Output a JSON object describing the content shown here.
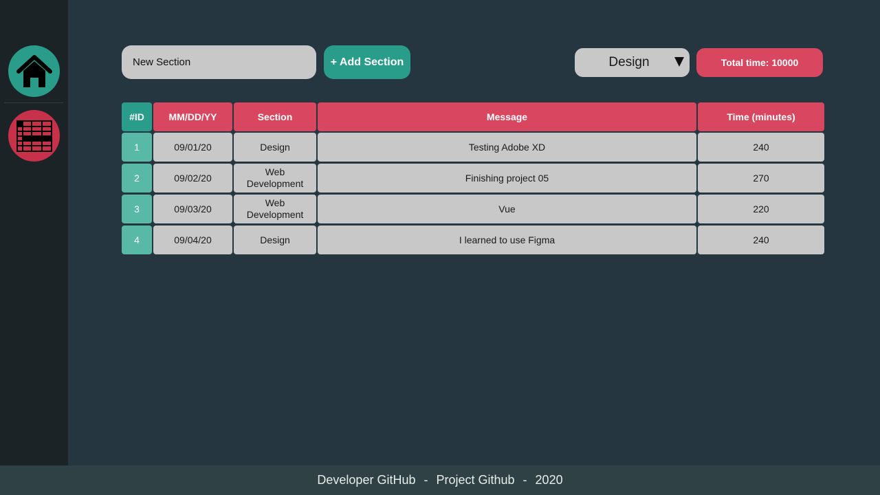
{
  "colors": {
    "background": "#263640",
    "sidebar": "#1c2326",
    "accent_teal": "#2a9d8a",
    "accent_red": "#d9465f",
    "cell_gray": "#c8c8c8"
  },
  "sidebar": {
    "items": [
      {
        "icon": "home-icon",
        "active": true
      },
      {
        "icon": "table-icon",
        "active": false
      }
    ]
  },
  "toolbar": {
    "section_input_value": "New Section",
    "add_button_label": "+ Add Section",
    "select_value": "Design",
    "total_time_label": "Total time: 10000"
  },
  "table": {
    "headers": [
      "#ID",
      "MM/DD/YY",
      "Section",
      "Message",
      "Time (minutes)"
    ],
    "rows": [
      {
        "id": "1",
        "date": "09/01/20",
        "section": "Design",
        "message": "Testing Adobe XD",
        "time": "240"
      },
      {
        "id": "2",
        "date": "09/02/20",
        "section": "Web Development",
        "message": "Finishing project 05",
        "time": "270"
      },
      {
        "id": "3",
        "date": "09/03/20",
        "section": "Web Development",
        "message": "Vue",
        "time": "220"
      },
      {
        "id": "4",
        "date": "09/04/20",
        "section": "Design",
        "message": "I learned to use Figma",
        "time": "240"
      }
    ]
  },
  "footer": {
    "developer": "Developer GitHub",
    "project": "Project Github",
    "year": "2020",
    "separator": "-"
  }
}
